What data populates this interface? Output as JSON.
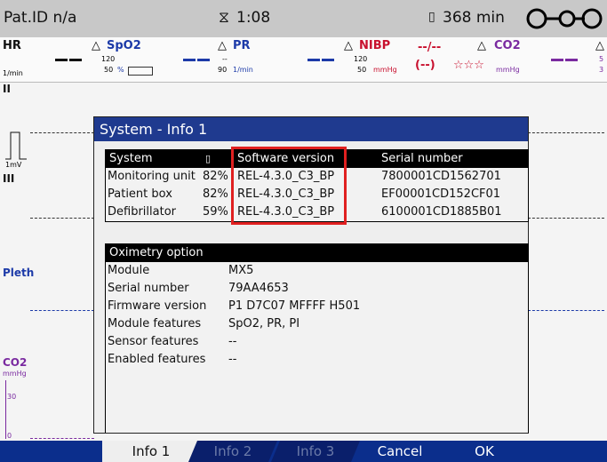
{
  "topbar": {
    "patient_id": "Pat.ID n/a",
    "timer_icon": "hourglass-icon",
    "timer": "1:08",
    "battery_icon": "battery-icon",
    "battery_time": "368 min",
    "connector_icon": "connector-icon"
  },
  "params": {
    "hr": {
      "label": "HR",
      "unit": "1/min"
    },
    "spo2": {
      "label": "SpO2",
      "hi": "120",
      "lo": "50",
      "unit": "%"
    },
    "pr": {
      "label": "PR",
      "hi": "--",
      "lo": "90",
      "unit": "1/min"
    },
    "nibp": {
      "label": "NIBP",
      "hi": "120",
      "lo": "50",
      "unit": "mmHg",
      "value": "--/--",
      "paren": "(--)",
      "stars": "☆☆☆"
    },
    "co2": {
      "label": "CO2",
      "unit": "mmHg",
      "hi": "5",
      "lo": "3"
    }
  },
  "waves": {
    "ii": "II",
    "scale": "1mV",
    "iii": "III",
    "pleth": "Pleth",
    "co2": "CO2",
    "co2_unit": "mmHg",
    "co2_30": "30",
    "co2_0": "0"
  },
  "dialog": {
    "title": "System - Info 1",
    "system_table": {
      "headers": [
        "System",
        "Software version",
        "Serial number"
      ],
      "rows": [
        {
          "name": "Monitoring unit",
          "battery": "82%",
          "version": "REL-4.3.0_C3_BP",
          "serial": "7800001CD1562701"
        },
        {
          "name": "Patient box",
          "battery": "82%",
          "version": "REL-4.3.0_C3_BP",
          "serial": "EF00001CD152CF01"
        },
        {
          "name": "Defibrillator",
          "battery": "59%",
          "version": "REL-4.3.0_C3_BP",
          "serial": "6100001CD1885B01"
        }
      ]
    },
    "oximetry_table": {
      "header": "Oximetry option",
      "rows": [
        {
          "label": "Module",
          "value": "MX5"
        },
        {
          "label": "Serial number",
          "value": "79AA4653"
        },
        {
          "label": "Firmware version",
          "value": "P1 D7C07 MFFFF H501"
        },
        {
          "label": "Module features",
          "value": "SpO2, PR, PI"
        },
        {
          "label": "Sensor features",
          "value": "--"
        },
        {
          "label": "Enabled features",
          "value": "--"
        }
      ]
    }
  },
  "tabs": {
    "info1": "Info 1",
    "info2": "Info 2",
    "info3": "Info 3",
    "cancel": "Cancel",
    "ok": "OK"
  }
}
